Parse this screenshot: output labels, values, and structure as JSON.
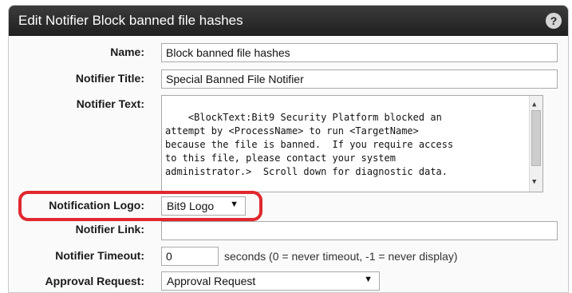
{
  "dialog": {
    "title": "Edit Notifier Block banned file hashes",
    "help_icon": "?"
  },
  "form": {
    "name": {
      "label": "Name:",
      "value": "Block banned file hashes"
    },
    "notifier_title": {
      "label": "Notifier Title:",
      "value": "Special Banned File Notifier"
    },
    "notifier_text": {
      "label": "Notifier Text:",
      "value": "<BlockText:Bit9 Security Platform blocked an\nattempt by <ProcessName> to run <TargetName>\nbecause the file is banned.  If you require access\nto this file, please contact your system\nadministrator.>  Scroll down for diagnostic data."
    },
    "notification_logo": {
      "label": "Notification Logo:",
      "selected": "Bit9 Logo"
    },
    "notifier_link": {
      "label": "Notifier Link:",
      "value": ""
    },
    "notifier_timeout": {
      "label": "Notifier Timeout:",
      "value": "0",
      "hint": "seconds (0 = never timeout, -1 = never display)"
    },
    "approval_request": {
      "label": "Approval Request:",
      "selected": "Approval Request"
    }
  },
  "colors": {
    "title_bar": "#2a2a2a",
    "highlight": "#e0282e"
  },
  "icons": {
    "help": "question-circle-icon",
    "dropdown": "triangle-down-icon",
    "scroll_up": "triangle-up-icon",
    "scroll_down": "triangle-down-icon"
  }
}
